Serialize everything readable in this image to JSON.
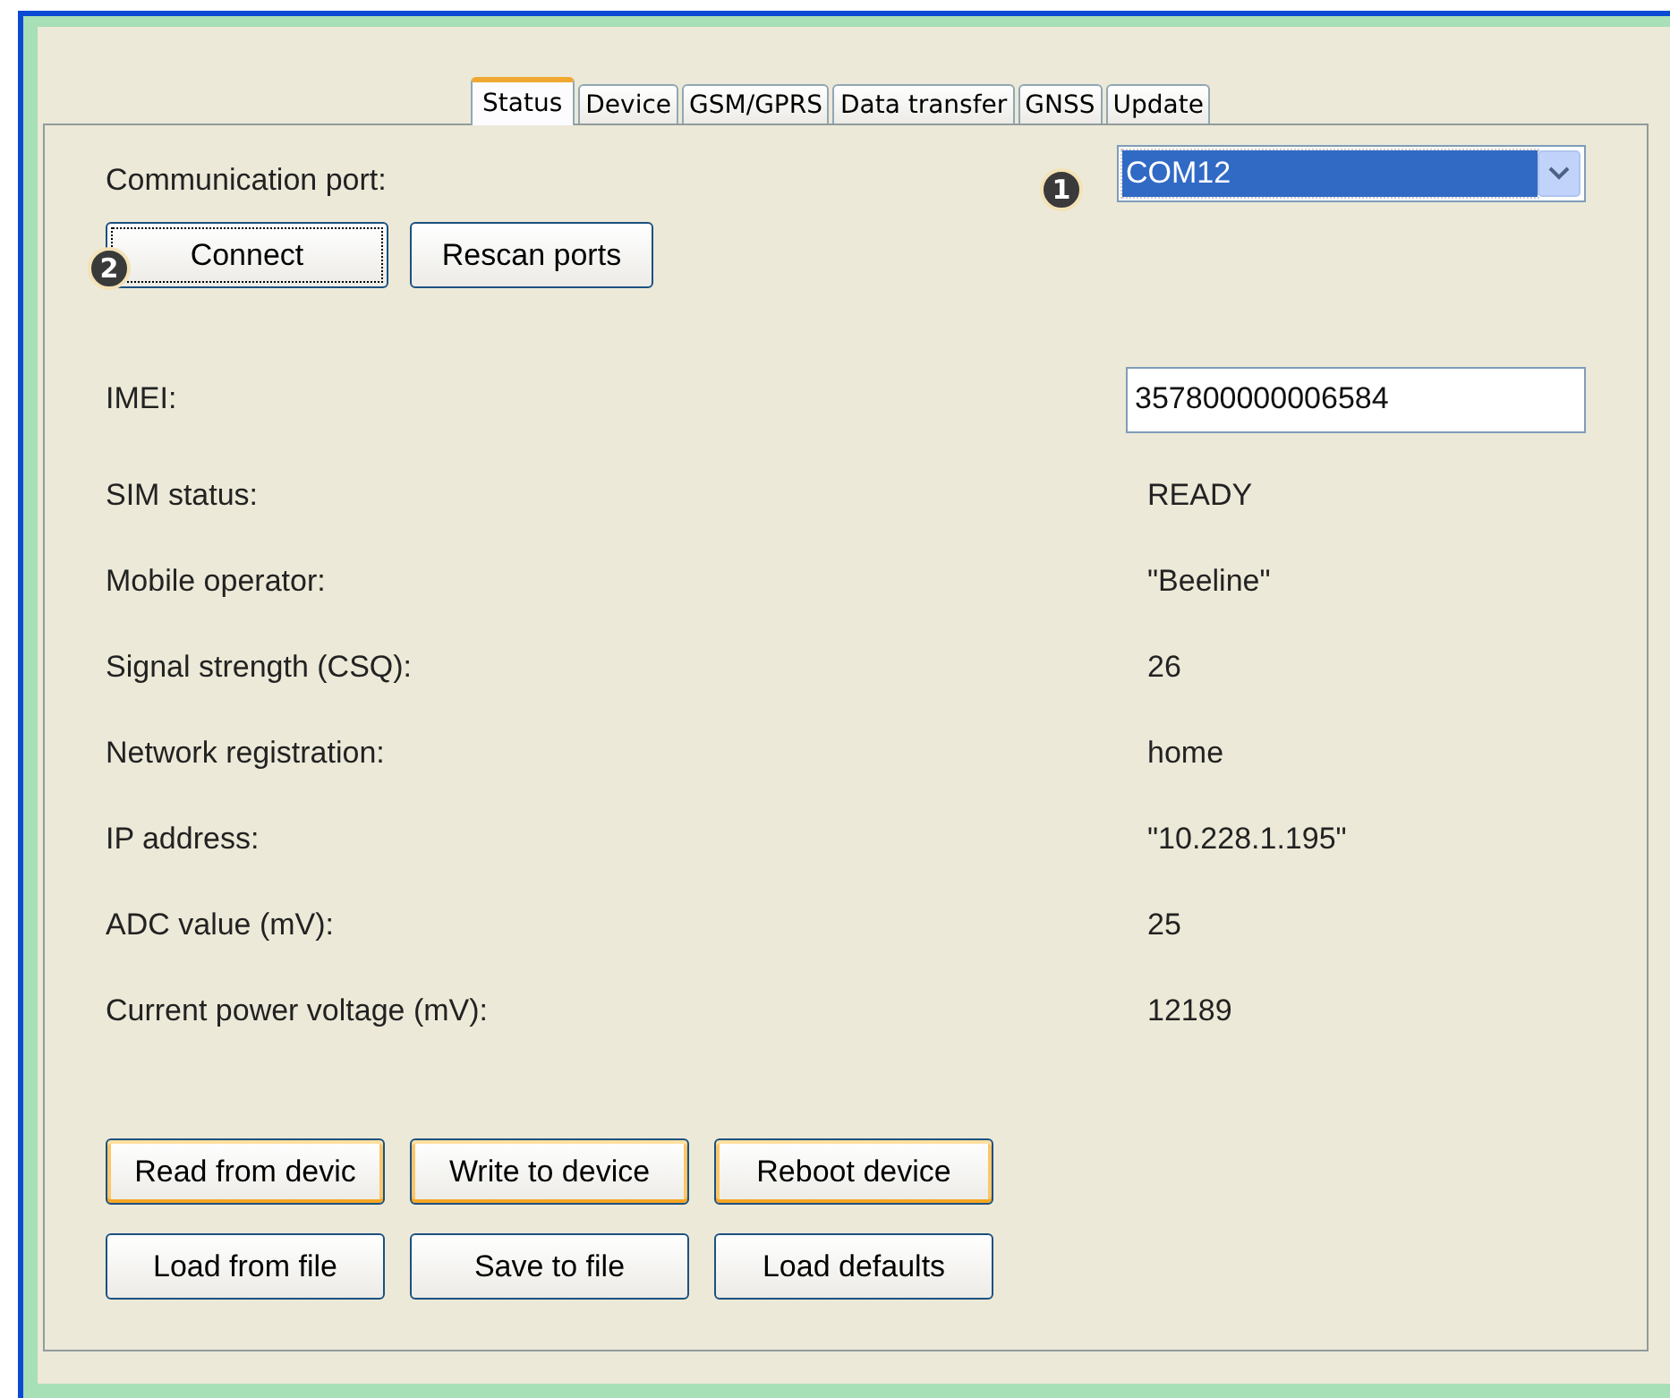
{
  "tabs": [
    {
      "label": "Status",
      "selected": true
    },
    {
      "label": "Device",
      "selected": false
    },
    {
      "label": "GSM/GPRS",
      "selected": false
    },
    {
      "label": "Data transfer",
      "selected": false
    },
    {
      "label": "GNSS",
      "selected": false
    },
    {
      "label": "Update",
      "selected": false
    }
  ],
  "port": {
    "label": "Communication port:",
    "value": "COM12",
    "marker": "1"
  },
  "port_buttons": [
    {
      "label": "Connect",
      "focused": true,
      "highlighted": false,
      "marker": "2"
    },
    {
      "label": "Rescan ports",
      "focused": false,
      "highlighted": false
    }
  ],
  "imei": {
    "label": "IMEI:",
    "value": "357800000006584"
  },
  "fields": [
    {
      "label": "SIM status:",
      "value": "READY"
    },
    {
      "label": "Mobile operator:",
      "value": "\"Beeline\""
    },
    {
      "label": "Signal strength (CSQ):",
      "value": "26"
    },
    {
      "label": "Network registration:",
      "value": "home"
    },
    {
      "label": "IP address:",
      "value": "\"10.228.1.195\""
    },
    {
      "label": "ADC value (mV):",
      "value": "25"
    },
    {
      "label": "Current power voltage (mV):",
      "value": "12189"
    }
  ],
  "action_buttons": [
    [
      {
        "label": "Read from devic",
        "focused": false,
        "highlighted": true
      },
      {
        "label": "Write to device",
        "focused": false,
        "highlighted": true
      },
      {
        "label": "Reboot device",
        "focused": false,
        "highlighted": true
      }
    ],
    [
      {
        "label": "Load from file",
        "focused": false,
        "highlighted": false
      },
      {
        "label": "Save to file",
        "focused": false,
        "highlighted": false
      },
      {
        "label": "Load defaults",
        "focused": false,
        "highlighted": false
      }
    ]
  ]
}
